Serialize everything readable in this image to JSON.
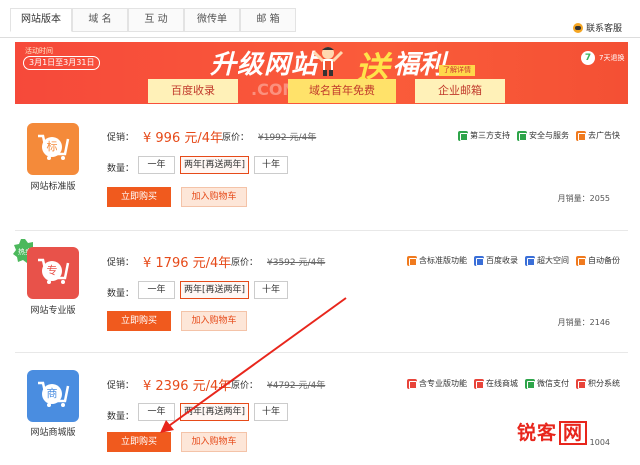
{
  "tabs": [
    {
      "label": "网站版本",
      "active": true
    },
    {
      "label": "域  名",
      "active": false
    },
    {
      "label": "互  动",
      "active": false
    },
    {
      "label": "微传单",
      "active": false
    },
    {
      "label": "邮  箱",
      "active": false
    }
  ],
  "service_label": "联系客服",
  "banner": {
    "activity_label": "活动时间",
    "date_range": "3月1日至3月31日",
    "title_part1": "升级网站",
    "title_part2": "送",
    "title_part3": "福利",
    "detail_link": "了解详情",
    "faint_text": ".COM",
    "pills": [
      "百度收录",
      "域名首年免费",
      "企业邮箱"
    ],
    "refund_badge": "7",
    "refund_text": "7天退换"
  },
  "labels": {
    "promo": "促销：",
    "original": "原价：",
    "quantity": "数量：",
    "buy_now": "立即购买",
    "add_cart": "加入购物车",
    "hot_badge": "热卖"
  },
  "quantity_options": [
    "一年",
    "两年[再送两年]",
    "十年"
  ],
  "colors": {
    "accent": "#f05a1e",
    "price": "#e64a19",
    "standard": "#f48a3a",
    "pro": "#e8524a",
    "mall": "#4a8de0"
  },
  "products": [
    {
      "name": "网站标准版",
      "logo_char": "标",
      "promo_price": "¥ 996 元/4年",
      "original_price": "¥1992 元/4年",
      "sales": "月销量：2055",
      "selected_option": 1,
      "features": [
        {
          "label": "第三方支持",
          "icon": "green-link-icon"
        },
        {
          "label": "安全与服务",
          "icon": "green-shield-icon"
        },
        {
          "label": "去广告快",
          "icon": "orange-ad-icon"
        }
      ]
    },
    {
      "name": "网站专业版",
      "logo_char": "专",
      "promo_price": "¥ 1796 元/4年",
      "original_price": "¥3592 元/4年",
      "sales": "月销量：2146",
      "selected_option": 1,
      "features": [
        {
          "label": "含标准版功能",
          "icon": "orange-standard-icon"
        },
        {
          "label": "百度收录",
          "icon": "blue-baidu-icon"
        },
        {
          "label": "超大空间",
          "icon": "blue-space-icon"
        },
        {
          "label": "自动备份",
          "icon": "orange-backup-icon"
        }
      ]
    },
    {
      "name": "网站商城版",
      "logo_char": "商",
      "promo_price": "¥ 2396 元/4年",
      "original_price": "¥4792 元/4年",
      "sales": "1004",
      "selected_option": 1,
      "features": [
        {
          "label": "含专业版功能",
          "icon": "red-pro-icon"
        },
        {
          "label": "在线商城",
          "icon": "red-mall-icon"
        },
        {
          "label": "微信支付",
          "icon": "green-wechat-icon"
        },
        {
          "label": "积分系统",
          "icon": "red-points-icon"
        }
      ]
    }
  ],
  "watermark": {
    "part1": "锐客",
    "part2": "网"
  }
}
